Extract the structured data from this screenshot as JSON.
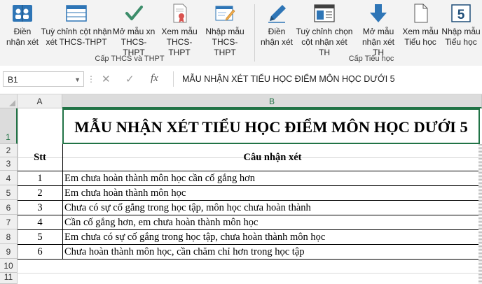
{
  "ribbon": {
    "buttons": [
      {
        "label1": "Điền",
        "label2": "nhận xét"
      },
      {
        "label1": "Tuỳ chỉnh cột nhận",
        "label2": "xét THCS-THPT"
      },
      {
        "label1": "Mở mẫu xn",
        "label2": "THCS-THPT"
      },
      {
        "label1": "Xem mẫu",
        "label2": "THCS-THPT"
      },
      {
        "label1": "Nhập mẫu",
        "label2": "THCS-THPT"
      },
      {
        "label1": "Điền",
        "label2": "nhận xét"
      },
      {
        "label1": "Tuỳ chỉnh chọn",
        "label2": "cột nhận xét TH"
      },
      {
        "label1": "Mở mẫu",
        "label2": "nhận xét TH"
      },
      {
        "label1": "Xem mẫu",
        "label2": "Tiểu học"
      },
      {
        "label1": "Nhập mẫu",
        "label2": "Tiểu học"
      }
    ],
    "groups": [
      "Cấp THCS và THPT",
      "Cấp Tiểu học"
    ]
  },
  "formula_bar": {
    "name_box": "B1",
    "fx": "fx",
    "formula": "MẪU NHẬN XÉT TIỂU HỌC ĐIỂM MÔN HỌC DƯỚI 5"
  },
  "columns": [
    "A",
    "B"
  ],
  "rows": [
    "1",
    "2",
    "3",
    "4",
    "5",
    "6",
    "7",
    "8",
    "9",
    "10",
    "11"
  ],
  "sheet": {
    "title": "MẪU NHẬN XÉT TIỂU HỌC ĐIỂM MÔN HỌC DƯỚI 5",
    "header_stt": "Stt",
    "header_comment": "Câu nhận xét",
    "entries": [
      {
        "stt": "1",
        "text": "Em chưa hoàn thành môn học cần cố gắng hơn"
      },
      {
        "stt": "2",
        "text": "Em chưa hoàn thành môn học"
      },
      {
        "stt": "3",
        "text": "Chưa có sự cố gắng trong học tập, môn học chưa hoàn thành"
      },
      {
        "stt": "4",
        "text": "Cần cố gắng hơn, em chưa hoàn thành môn học"
      },
      {
        "stt": "5",
        "text": "Em chưa có sự cố gắng trong học tập, chưa hoàn thành môn học"
      },
      {
        "stt": "6",
        "text": "Chưa hoàn thành môn học, cần chăm chỉ hơn trong học tập"
      }
    ]
  },
  "colors": {
    "accent": "#217346",
    "icon_blue": "#2e75b6",
    "icon_green": "#3c8d6a"
  }
}
